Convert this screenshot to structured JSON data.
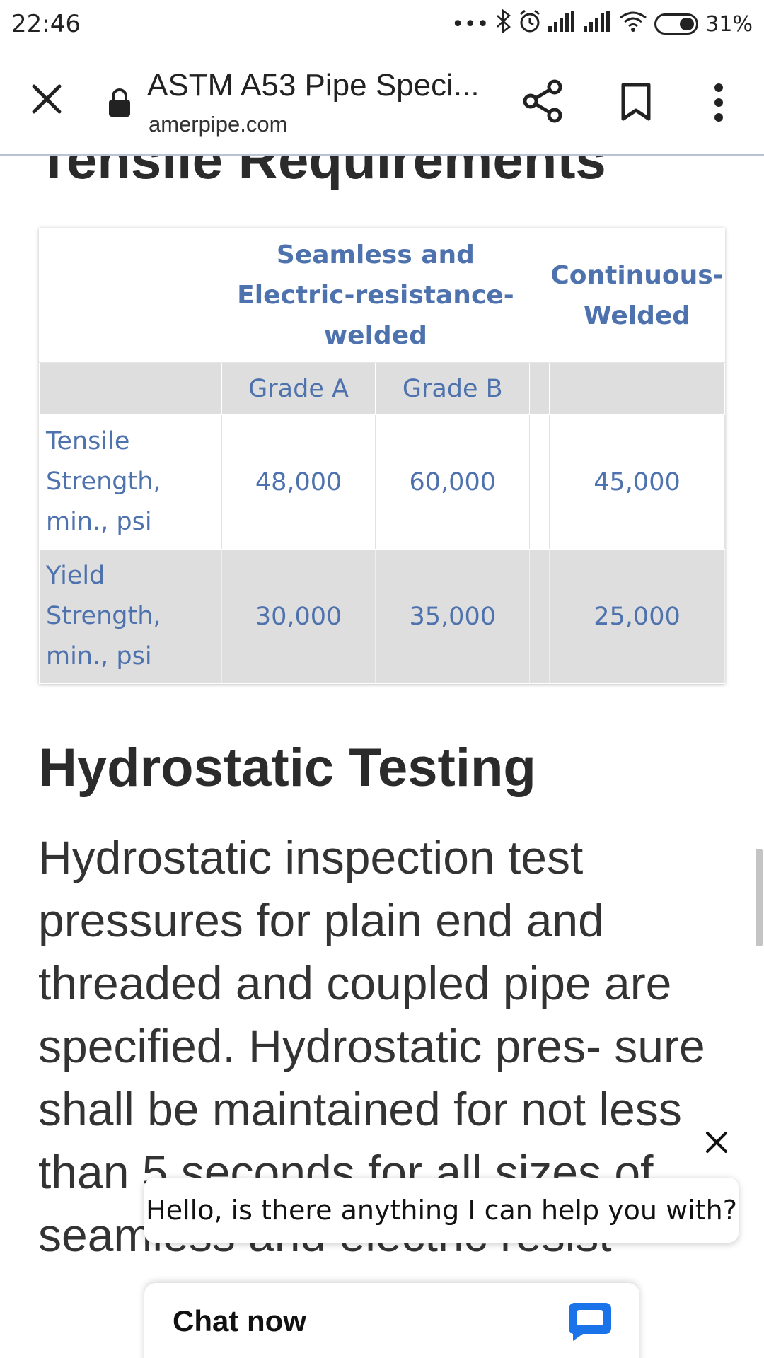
{
  "status_bar": {
    "time": "22:46",
    "battery": "31%",
    "icons": [
      "more-dots-icon",
      "bluetooth-icon",
      "alarm-icon",
      "signal-icon",
      "signal-icon",
      "wifi-icon",
      "battery-icon"
    ]
  },
  "toolbar": {
    "title": "ASTM A53 Pipe Speci...",
    "url": "amerpipe.com"
  },
  "content": {
    "section_heading_cut": "Tensile Requirements",
    "table": {
      "header_group": "Seamless and Electric-resistance-welded",
      "header_group_lines": [
        "Seamless and",
        "Electric-resistance-",
        "welded"
      ],
      "header_cw_lines": [
        "Continuous-",
        "Welded"
      ],
      "grade_a": "Grade A",
      "grade_b": "Grade B",
      "rows": [
        {
          "label_lines": [
            "Tensile",
            "Strength,",
            "min., psi"
          ],
          "a": "48,000",
          "b": "60,000",
          "cw": "45,000"
        },
        {
          "label_lines": [
            "Yield",
            "Strength,",
            "min., psi"
          ],
          "a": "30,000",
          "b": "35,000",
          "cw": "25,000"
        }
      ]
    },
    "heading": "Hydrostatic Testing",
    "paragraph": "Hydrostatic inspection test pressures for plain end and threaded and coupled pipe are specified. Hydrostatic pres- sure shall be maintained for not less than 5 seconds for all sizes of seamless and electric resist"
  },
  "chat": {
    "bubble_text": "Hello, is there anything I can help you with?",
    "button_label": "Chat now"
  }
}
